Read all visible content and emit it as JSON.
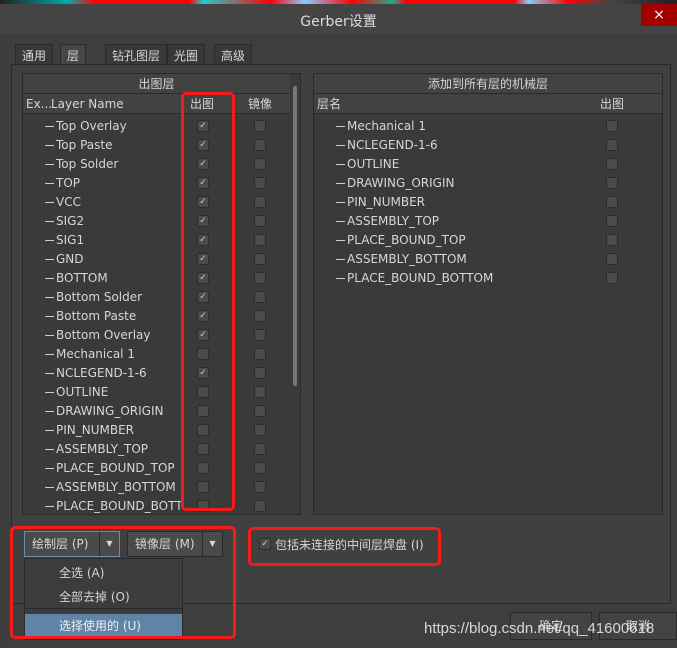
{
  "window": {
    "title": "Gerber设置",
    "close": "×"
  },
  "tabs": [
    "通用",
    "层",
    "钻孔图层",
    "光圈",
    "高级"
  ],
  "left_panel": {
    "title": "出图层",
    "columns": {
      "expand": "Ex...",
      "name": "Layer Name",
      "plot": "出图",
      "mirror": "镜像"
    },
    "rows": [
      {
        "name": "Top Overlay",
        "plot": true,
        "mirror": false
      },
      {
        "name": "Top Paste",
        "plot": true,
        "mirror": false
      },
      {
        "name": "Top Solder",
        "plot": true,
        "mirror": false
      },
      {
        "name": "TOP",
        "plot": true,
        "mirror": false
      },
      {
        "name": "VCC",
        "plot": true,
        "mirror": false
      },
      {
        "name": "SIG2",
        "plot": true,
        "mirror": false
      },
      {
        "name": "SIG1",
        "plot": true,
        "mirror": false
      },
      {
        "name": "GND",
        "plot": true,
        "mirror": false
      },
      {
        "name": "BOTTOM",
        "plot": true,
        "mirror": false
      },
      {
        "name": "Bottom Solder",
        "plot": true,
        "mirror": false
      },
      {
        "name": "Bottom Paste",
        "plot": true,
        "mirror": false
      },
      {
        "name": "Bottom Overlay",
        "plot": true,
        "mirror": false
      },
      {
        "name": "Mechanical 1",
        "plot": false,
        "mirror": false
      },
      {
        "name": "NCLEGEND-1-6",
        "plot": true,
        "mirror": false
      },
      {
        "name": "OUTLINE",
        "plot": false,
        "mirror": false
      },
      {
        "name": "DRAWING_ORIGIN",
        "plot": false,
        "mirror": false
      },
      {
        "name": "PIN_NUMBER",
        "plot": false,
        "mirror": false
      },
      {
        "name": "ASSEMBLY_TOP",
        "plot": false,
        "mirror": false
      },
      {
        "name": "PLACE_BOUND_TOP",
        "plot": false,
        "mirror": false
      },
      {
        "name": "ASSEMBLY_BOTTOM",
        "plot": false,
        "mirror": false
      },
      {
        "name": "PLACE_BOUND_BOTT",
        "plot": false,
        "mirror": false
      }
    ]
  },
  "right_panel": {
    "title": "添加到所有层的机械层",
    "columns": {
      "name": "层名",
      "plot": "出图"
    },
    "rows": [
      {
        "name": "Mechanical 1",
        "plot": false
      },
      {
        "name": "NCLEGEND-1-6",
        "plot": false
      },
      {
        "name": "OUTLINE",
        "plot": false
      },
      {
        "name": "DRAWING_ORIGIN",
        "plot": false
      },
      {
        "name": "PIN_NUMBER",
        "plot": false
      },
      {
        "name": "ASSEMBLY_TOP",
        "plot": false
      },
      {
        "name": "PLACE_BOUND_TOP",
        "plot": false
      },
      {
        "name": "ASSEMBLY_BOTTOM",
        "plot": false
      },
      {
        "name": "PLACE_BOUND_BOTTOM",
        "plot": false
      }
    ]
  },
  "buttons": {
    "plot_layers": "绘制层 (P)",
    "mirror_layers": "镜像层 (M)",
    "ok": "确定",
    "cancel": "取消"
  },
  "menu": [
    "全选 (A)",
    "全部去掉 (O)",
    "选择使用的 (U)"
  ],
  "include_pads": {
    "label": "包括未连接的中间层焊盘 (I)",
    "checked": true
  },
  "watermark": "https://blog.csdn.net/qq_41600618",
  "colors": {
    "highlight": "#f41b1b",
    "close": "#a30000",
    "menu_selected": "#5f84a8"
  }
}
